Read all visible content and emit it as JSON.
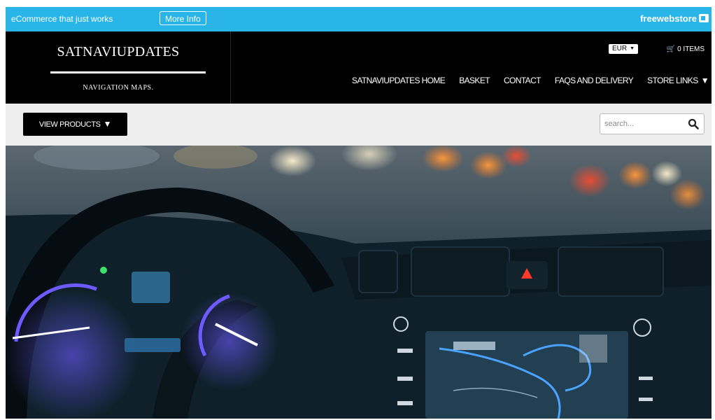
{
  "promo": {
    "tagline": "eCommerce that just works",
    "more_info": "More Info",
    "brand": "freewebstore"
  },
  "store": {
    "name": "SATNAVIUPDATES",
    "tagline": "NAVIGATION MAPS."
  },
  "currency": {
    "selected": "EUR"
  },
  "cart": {
    "label": "0 ITEMS"
  },
  "nav": {
    "items": [
      "SATNAVIUPDATES HOME",
      "BASKET",
      "CONTACT",
      "FAQS AND DELIVERY",
      "STORE LINKS"
    ]
  },
  "subbar": {
    "view_products": "VIEW PRODUCTS",
    "search_placeholder": "search..."
  },
  "icons": {
    "cart": "cart-icon",
    "search": "search-icon",
    "dropdown": "caret-down-icon"
  },
  "colors": {
    "promo_bar": "#29b5e8",
    "header": "#000000",
    "subbar": "#eeeeee"
  }
}
